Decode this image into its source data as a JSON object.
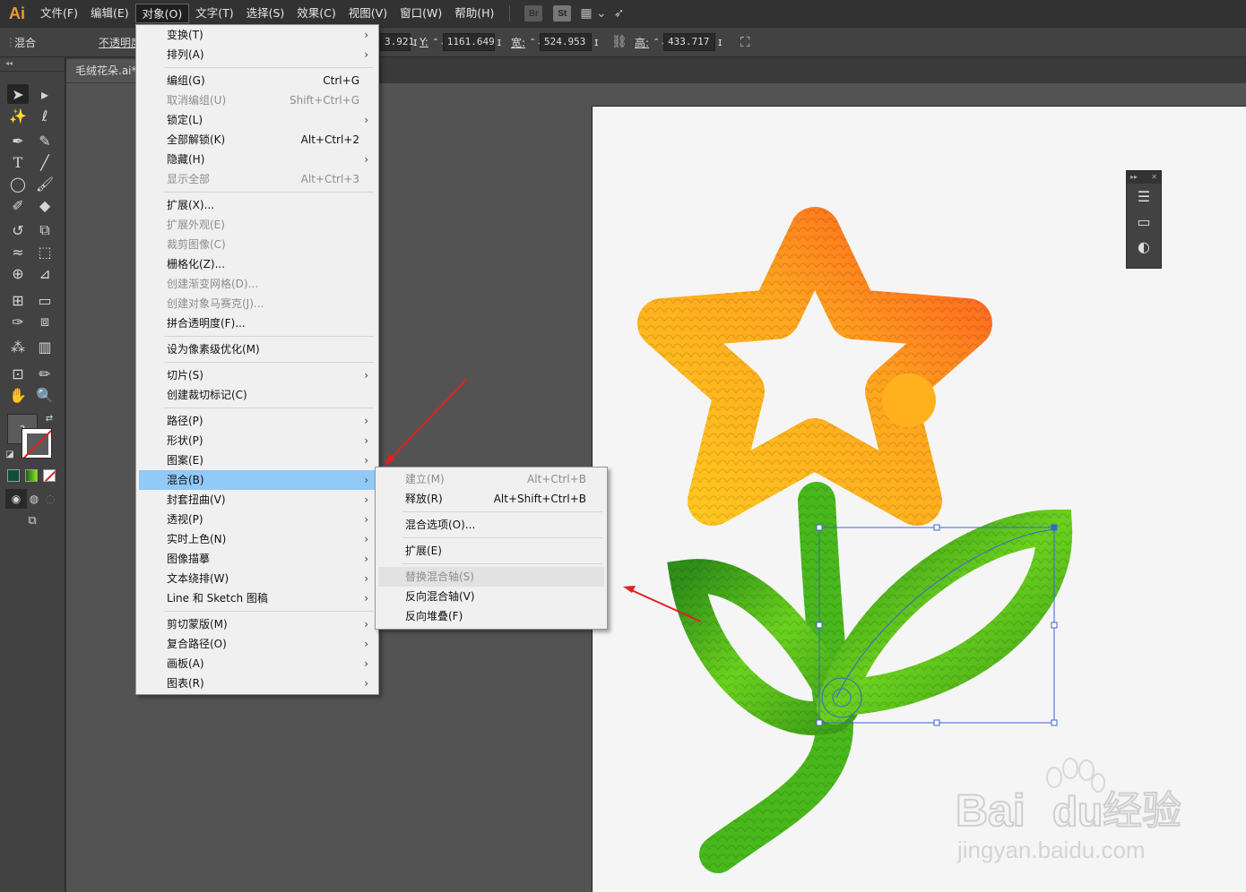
{
  "app": {
    "logo": "Ai"
  },
  "menubar": {
    "items": [
      "文件(F)",
      "编辑(E)",
      "对象(O)",
      "文字(T)",
      "选择(S)",
      "效果(C)",
      "视图(V)",
      "窗口(W)",
      "帮助(H)"
    ],
    "bridge": "Br",
    "stock": "St"
  },
  "controlbar": {
    "selection_type": "混合",
    "opacity_label": "不透明度",
    "x_value": "3.921",
    "y_label": "Y:",
    "y_value": "1161.649",
    "w_label": "宽:",
    "w_value": "524.953",
    "h_label": "高:",
    "h_value": "433.717"
  },
  "document": {
    "tab_title": "毛绒花朵.ai*"
  },
  "toolbar": {
    "unknown_fill": "?"
  },
  "object_menu": {
    "items": [
      {
        "label": "变换(T)",
        "shortcut": "",
        "submenu": true,
        "disabled": false
      },
      {
        "label": "排列(A)",
        "shortcut": "",
        "submenu": true,
        "disabled": false
      },
      {
        "label": "编组(G)",
        "shortcut": "Ctrl+G",
        "submenu": false,
        "disabled": false
      },
      {
        "label": "取消编组(U)",
        "shortcut": "Shift+Ctrl+G",
        "submenu": false,
        "disabled": true
      },
      {
        "label": "锁定(L)",
        "shortcut": "",
        "submenu": true,
        "disabled": false
      },
      {
        "label": "全部解锁(K)",
        "shortcut": "Alt+Ctrl+2",
        "submenu": false,
        "disabled": false
      },
      {
        "label": "隐藏(H)",
        "shortcut": "",
        "submenu": true,
        "disabled": false
      },
      {
        "label": "显示全部",
        "shortcut": "Alt+Ctrl+3",
        "submenu": false,
        "disabled": true
      },
      {
        "label": "扩展(X)...",
        "shortcut": "",
        "submenu": false,
        "disabled": false
      },
      {
        "label": "扩展外观(E)",
        "shortcut": "",
        "submenu": false,
        "disabled": true
      },
      {
        "label": "裁剪图像(C)",
        "shortcut": "",
        "submenu": false,
        "disabled": true
      },
      {
        "label": "栅格化(Z)...",
        "shortcut": "",
        "submenu": false,
        "disabled": false
      },
      {
        "label": "创建渐变网格(D)...",
        "shortcut": "",
        "submenu": false,
        "disabled": true
      },
      {
        "label": "创建对象马赛克(J)...",
        "shortcut": "",
        "submenu": false,
        "disabled": true
      },
      {
        "label": "拼合透明度(F)...",
        "shortcut": "",
        "submenu": false,
        "disabled": false
      },
      {
        "label": "设为像素级优化(M)",
        "shortcut": "",
        "submenu": false,
        "disabled": false
      },
      {
        "label": "切片(S)",
        "shortcut": "",
        "submenu": true,
        "disabled": false
      },
      {
        "label": "创建裁切标记(C)",
        "shortcut": "",
        "submenu": false,
        "disabled": false
      },
      {
        "label": "路径(P)",
        "shortcut": "",
        "submenu": true,
        "disabled": false
      },
      {
        "label": "形状(P)",
        "shortcut": "",
        "submenu": true,
        "disabled": false
      },
      {
        "label": "图案(E)",
        "shortcut": "",
        "submenu": true,
        "disabled": false
      },
      {
        "label": "混合(B)",
        "shortcut": "",
        "submenu": true,
        "disabled": false
      },
      {
        "label": "封套扭曲(V)",
        "shortcut": "",
        "submenu": true,
        "disabled": false
      },
      {
        "label": "透视(P)",
        "shortcut": "",
        "submenu": true,
        "disabled": false
      },
      {
        "label": "实时上色(N)",
        "shortcut": "",
        "submenu": true,
        "disabled": false
      },
      {
        "label": "图像描摹",
        "shortcut": "",
        "submenu": true,
        "disabled": false
      },
      {
        "label": "文本绕排(W)",
        "shortcut": "",
        "submenu": true,
        "disabled": false
      },
      {
        "label": "Line 和 Sketch 图稿",
        "shortcut": "",
        "submenu": true,
        "disabled": false
      },
      {
        "label": "剪切蒙版(M)",
        "shortcut": "",
        "submenu": true,
        "disabled": false
      },
      {
        "label": "复合路径(O)",
        "shortcut": "",
        "submenu": true,
        "disabled": false
      },
      {
        "label": "画板(A)",
        "shortcut": "",
        "submenu": true,
        "disabled": false
      },
      {
        "label": "图表(R)",
        "shortcut": "",
        "submenu": true,
        "disabled": false
      }
    ]
  },
  "blend_submenu": {
    "items": [
      {
        "label": "建立(M)",
        "shortcut": "Alt+Ctrl+B",
        "disabled": true
      },
      {
        "label": "释放(R)",
        "shortcut": "Alt+Shift+Ctrl+B",
        "disabled": false
      },
      {
        "label": "混合选项(O)...",
        "shortcut": "",
        "disabled": false
      },
      {
        "label": "扩展(E)",
        "shortcut": "",
        "disabled": false
      },
      {
        "label": "替换混合轴(S)",
        "shortcut": "",
        "disabled": true
      },
      {
        "label": "反向混合轴(V)",
        "shortcut": "",
        "disabled": false
      },
      {
        "label": "反向堆叠(F)",
        "shortcut": "",
        "disabled": false
      }
    ]
  },
  "watermark": {
    "brand": "Bai",
    "brand2": "du",
    "cn": "经验",
    "url": "jingyan.baidu.com"
  },
  "colors": {
    "accent_highlight": "#91c9f7",
    "arrow": "#e02020",
    "star_a": "#ffc81e",
    "star_b": "#ff5a20",
    "leaf_a": "#8be21e",
    "leaf_b": "#2f8f18"
  },
  "icons": [
    "selection-tool-icon",
    "direct-selection-icon",
    "magic-wand-icon",
    "lasso-icon",
    "pen-icon",
    "curvature-icon",
    "type-icon",
    "line-icon",
    "ellipse-icon",
    "paintbrush-icon",
    "shaper-icon",
    "eraser-icon",
    "rotate-icon",
    "scale-icon",
    "warp-icon",
    "free-transform-icon",
    "shape-builder-icon",
    "perspective-icon",
    "mesh-icon",
    "gradient-icon",
    "eyedropper-icon",
    "blend-icon",
    "symbol-sprayer-icon",
    "graph-icon",
    "artboard-icon",
    "slice-icon",
    "hand-icon",
    "zoom-icon"
  ]
}
